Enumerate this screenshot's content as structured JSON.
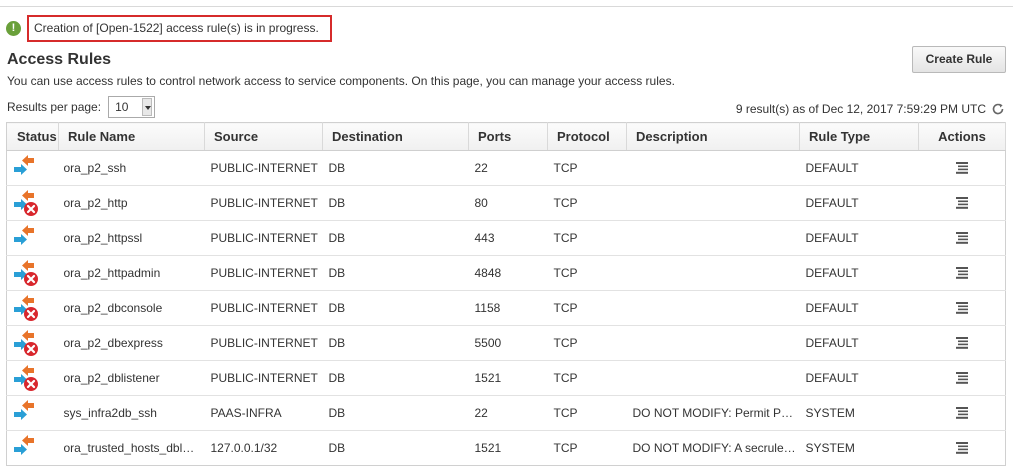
{
  "notice": {
    "text": "Creation of [Open-1522] access rule(s) is in progress.",
    "icon": "exclamation-circle-icon",
    "color": "#d62b2b"
  },
  "page": {
    "title": "Access Rules",
    "subtitle": "You can use access rules to control network access to service components. On this page, you can manage your access rules.",
    "create_label": "Create Rule"
  },
  "pager": {
    "label": "Results per page:",
    "value": "10"
  },
  "results": {
    "text": "9 result(s) as of Dec 12, 2017 7:59:29 PM UTC"
  },
  "table": {
    "columns": [
      "Status",
      "Rule Name",
      "Source",
      "Destination",
      "Ports",
      "Protocol",
      "Description",
      "Rule Type",
      "Actions"
    ],
    "rows": [
      {
        "status": "enabled",
        "name": "ora_p2_ssh",
        "source": "PUBLIC-INTERNET",
        "destination": "DB",
        "ports": "22",
        "protocol": "TCP",
        "description": "",
        "type": "DEFAULT"
      },
      {
        "status": "disabled",
        "name": "ora_p2_http",
        "source": "PUBLIC-INTERNET",
        "destination": "DB",
        "ports": "80",
        "protocol": "TCP",
        "description": "",
        "type": "DEFAULT"
      },
      {
        "status": "enabled",
        "name": "ora_p2_httpssl",
        "source": "PUBLIC-INTERNET",
        "destination": "DB",
        "ports": "443",
        "protocol": "TCP",
        "description": "",
        "type": "DEFAULT"
      },
      {
        "status": "disabled",
        "name": "ora_p2_httpadmin",
        "source": "PUBLIC-INTERNET",
        "destination": "DB",
        "ports": "4848",
        "protocol": "TCP",
        "description": "",
        "type": "DEFAULT"
      },
      {
        "status": "disabled",
        "name": "ora_p2_dbconsole",
        "source": "PUBLIC-INTERNET",
        "destination": "DB",
        "ports": "1158",
        "protocol": "TCP",
        "description": "",
        "type": "DEFAULT"
      },
      {
        "status": "disabled",
        "name": "ora_p2_dbexpress",
        "source": "PUBLIC-INTERNET",
        "destination": "DB",
        "ports": "5500",
        "protocol": "TCP",
        "description": "",
        "type": "DEFAULT"
      },
      {
        "status": "disabled",
        "name": "ora_p2_dblistener",
        "source": "PUBLIC-INTERNET",
        "destination": "DB",
        "ports": "1521",
        "protocol": "TCP",
        "description": "",
        "type": "DEFAULT"
      },
      {
        "status": "enabled",
        "name": "sys_infra2db_ssh",
        "source": "PAAS-INFRA",
        "destination": "DB",
        "ports": "22",
        "protocol": "TCP",
        "description": "DO NOT MODIFY: Permit P…",
        "type": "SYSTEM"
      },
      {
        "status": "enabled",
        "name": "ora_trusted_hosts_dbl…",
        "source": "127.0.0.1/32",
        "destination": "DB",
        "ports": "1521",
        "protocol": "TCP",
        "description": "DO NOT MODIFY: A secrule…",
        "type": "SYSTEM"
      }
    ]
  },
  "icons": {
    "status_enabled": "access-rule-arrows-icon",
    "status_disabled": "access-rule-disabled-icon",
    "actions": "actions-menu-icon",
    "refresh": "refresh-icon"
  },
  "colors": {
    "arrow_blue": "#2a9fd6",
    "arrow_orange": "#e8742a",
    "disabled_red": "#d8272d",
    "success_green": "#6aa03a"
  }
}
